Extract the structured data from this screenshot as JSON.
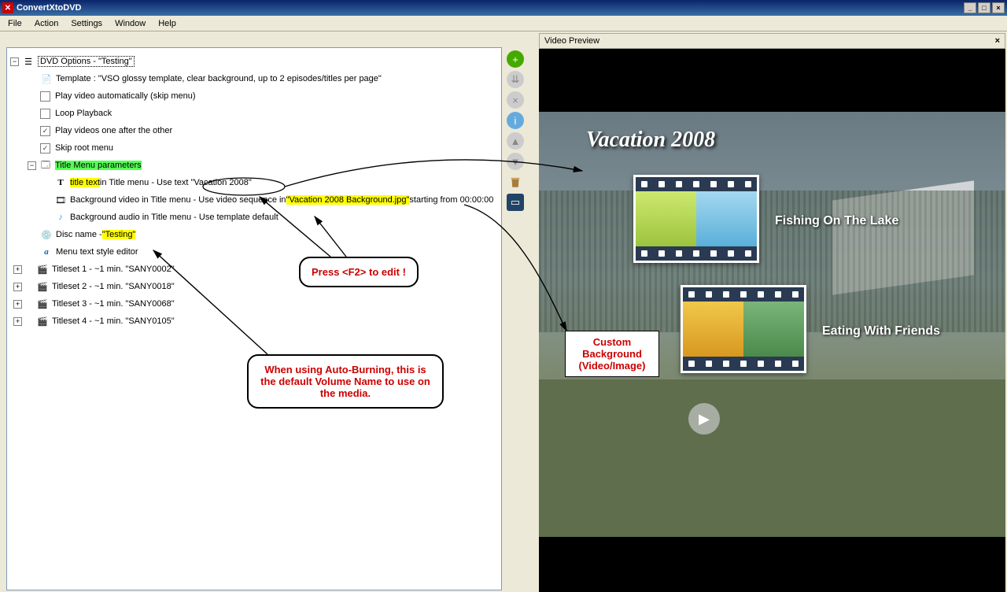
{
  "app": {
    "title": "ConvertXtoDVD"
  },
  "menu": {
    "file": "File",
    "action": "Action",
    "settings": "Settings",
    "window": "Window",
    "help": "Help"
  },
  "preview": {
    "header": "Video Preview",
    "title": "Vacation 2008",
    "ep1": "Fishing On The Lake",
    "ep2": "Eating With Friends"
  },
  "tree": {
    "root": "DVD Options - \"Testing\"",
    "template": "Template : \"VSO glossy template, clear background, up to 2 episodes/titles per page\"",
    "playauto": "Play video automatically (skip menu)",
    "loop": "Loop Playback",
    "oneafter": "Play videos one after the other",
    "skiproot": "Skip root menu",
    "titlemenu": "Title Menu parameters",
    "titletext_pre": "title text",
    "titletext_mid": " in Title menu - Use text \"Vacation 2008\"",
    "bgvideo_pre": "Background video in Title menu - Use video sequence in ",
    "bgvideo_hl": "\"Vacation 2008 Background.jpg\"",
    "bgvideo_post": " starting from 00:00:00",
    "bgaudio": "Background audio in Title menu - Use template default",
    "disc_pre": "Disc name - ",
    "disc_hl": "\"Testing\"",
    "style": "Menu text style editor",
    "ts1": "Titleset 1 - ~1 min. \"SANY0002\"",
    "ts2": "Titleset 2 - ~1 min. \"SANY0018\"",
    "ts3": "Titleset 3 - ~1 min. \"SANY0068\"",
    "ts4": "Titleset 4 - ~1 min. \"SANY0105\""
  },
  "callouts": {
    "edit": "Press <F2> to edit !",
    "volume": "When using Auto-Burning, this is the default Volume Name to use on the media.",
    "custom": "Custom Background (Video/Image)"
  }
}
